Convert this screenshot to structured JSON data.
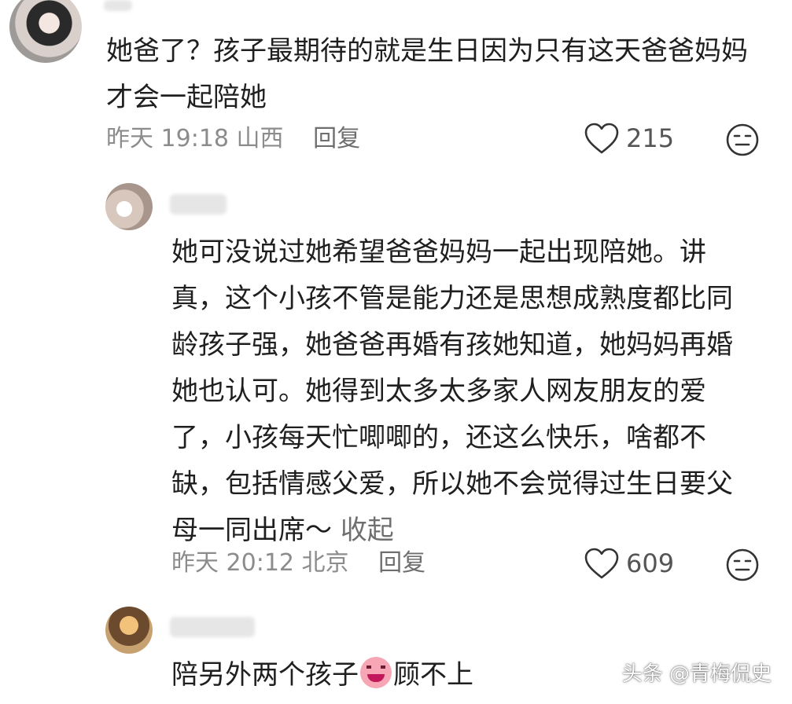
{
  "comments": [
    {
      "text": "她爸了？孩子最期待的就是生日因为只有这天爸爸妈妈才会一起陪她",
      "time": "昨天 19:18 山西",
      "reply": "回复",
      "likes": "215"
    },
    {
      "text": "她可没说过她希望爸爸妈妈一起出现陪她。讲真，这个小孩不管是能力还是思想成熟度都比同龄孩子强，她爸爸再婚有孩她知道，她妈妈再婚她也认可。她得到太多太多家人网友朋友的爱了，小孩每天忙唧唧的，还这么快乐，啥都不缺，包括情感父爱，所以她不会觉得过生日要父母一同出席～",
      "collapse": "收起",
      "time": "昨天 20:12 北京",
      "reply": "回复",
      "likes": "609"
    },
    {
      "text_before": "陪另外两个孩子",
      "text_after": "顾不上"
    }
  ],
  "watermark": "头条 @青梅侃史",
  "colors": {
    "text": "#1f1f1f",
    "meta": "#8c8c8c",
    "background": "#ffffff"
  },
  "icons": [
    "heart-icon",
    "dislike-face-icon",
    "emoji-icon"
  ]
}
